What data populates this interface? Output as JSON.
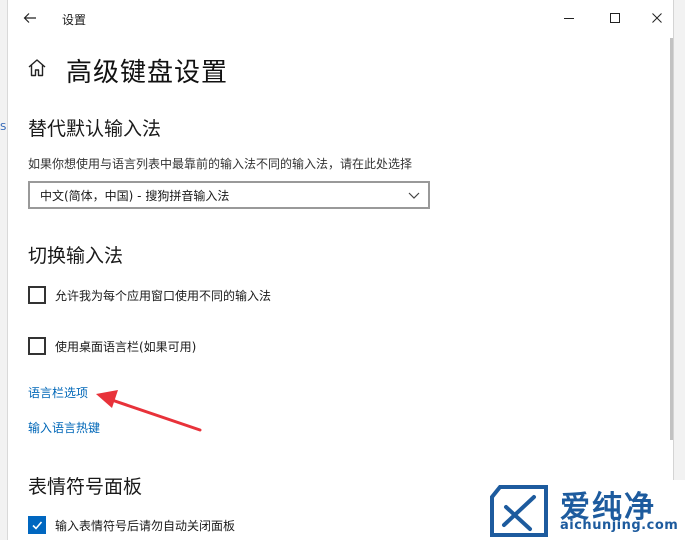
{
  "window": {
    "title": "设置",
    "page_title": "高级键盘设置"
  },
  "sections": {
    "override_title": "替代默认输入法",
    "override_desc": "如果你想使用与语言列表中最靠前的输入法不同的输入法，请在此处选择",
    "input_method_selected": "中文(简体，中国) - 搜狗拼音输入法",
    "switch_title": "切换输入法",
    "checkbox_per_app": "允许我为每个应用窗口使用不同的输入法",
    "checkbox_desktop_bar": "使用桌面语言栏(如果可用)",
    "link_language_bar_options": "语言栏选项",
    "link_input_hotkeys": "输入语言热键",
    "emoji_title": "表情符号面板",
    "checkbox_emoji_close": "输入表情符号后请勿自动关闭面板"
  },
  "checkbox_states": {
    "per_app": false,
    "desktop_bar": false,
    "emoji_close": true
  },
  "watermark": {
    "cn": "爱纯净",
    "url": "aichunjing.com"
  },
  "colors": {
    "link": "#0067b8",
    "accent": "#0067c0",
    "arrow": "#e8323a",
    "watermark": "#1d5b9e"
  }
}
